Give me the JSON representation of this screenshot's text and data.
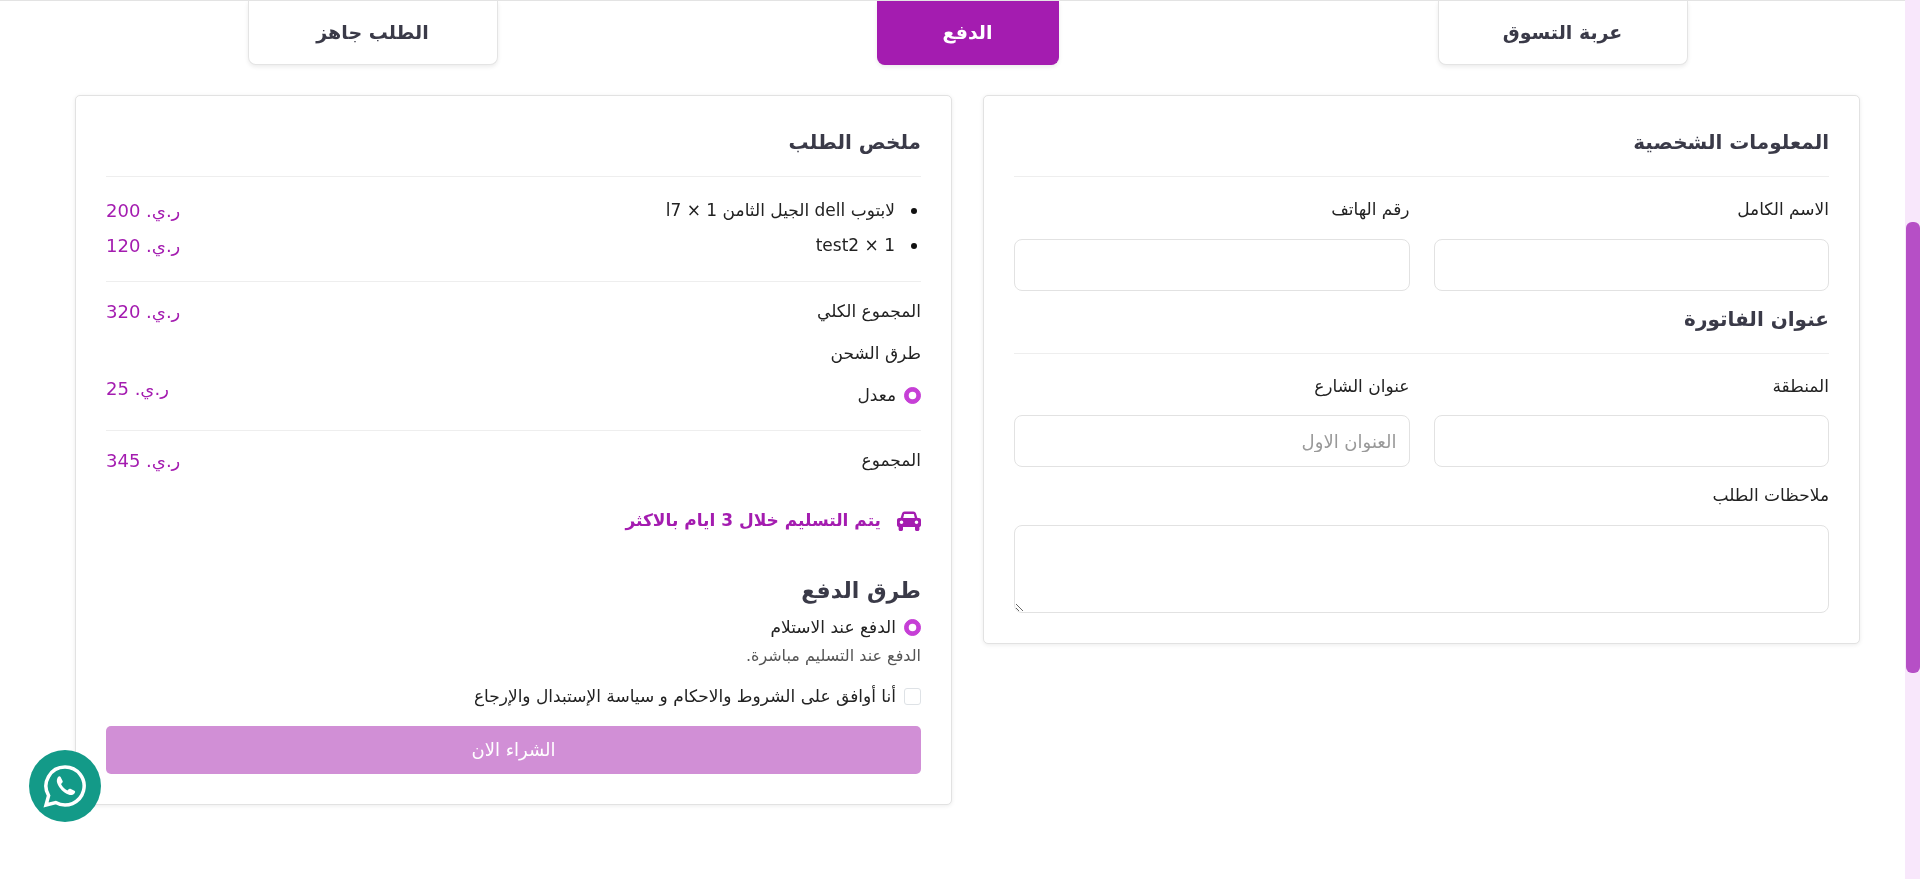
{
  "steps": [
    {
      "label": "عربة التسوق",
      "selected": false
    },
    {
      "label": "الدفع",
      "selected": true
    },
    {
      "label": "الطلب جاهز",
      "selected": false
    }
  ],
  "personal_info": {
    "title": "المعلومات الشخصية",
    "fields": [
      {
        "label": "الاسم الكامل"
      },
      {
        "label": "رقم الهاتف"
      }
    ]
  },
  "billing_address": {
    "title": "عنوان الفاتورة",
    "fields": [
      {
        "label": "المنطقة"
      },
      {
        "label": "عنوان الشارع",
        "placeholder": "العنوان الاول"
      }
    ]
  },
  "order_notes": {
    "label": "ملاحظات الطلب"
  },
  "order_summary": {
    "title": "ملخص الطلب",
    "items": [
      {
        "label": "لابتوب dell الجيل الثامن l7 × 1",
        "price": "ر.ي. 200"
      },
      {
        "label": "test2 × 1",
        "price": "ر.ي. 120"
      }
    ],
    "subtotal": {
      "label": "المجموع الكلي",
      "value": "ر.ي. 320"
    },
    "shipping": {
      "title": "طرق الشحن",
      "options": [
        {
          "label": "معدل",
          "price": "ر.ي. 25",
          "selected": true
        }
      ]
    },
    "total": {
      "label": "المجموع",
      "value": "ر.ي. 345"
    },
    "delivery_note": "يتم التسليم خلال 3 ايام بالاكثر"
  },
  "payment": {
    "title": "طرق الدفع",
    "methods": [
      {
        "label": "الدفع عند الاستلام",
        "description": "الدفع عند التسليم مباشرة.",
        "selected": true
      }
    ],
    "terms": {
      "label": "أنا أوافق على الشروط والاحكام و سياسة الإستبدال والإرجاع",
      "checked": false
    },
    "submit": {
      "label": "الشراء الان",
      "disabled": true
    }
  }
}
